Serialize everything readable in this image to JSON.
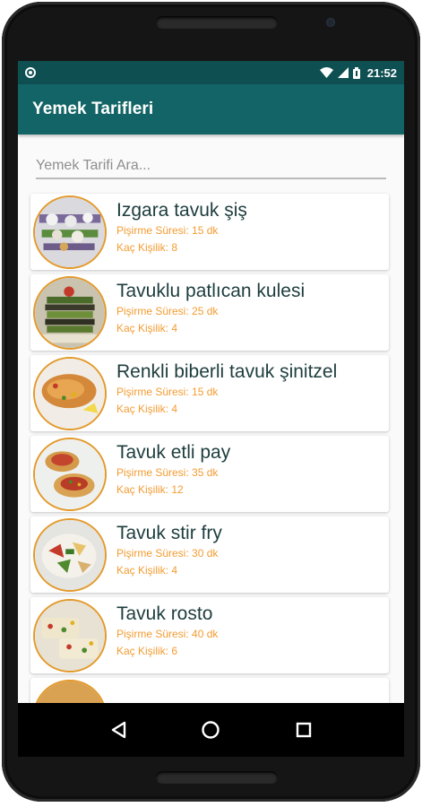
{
  "status_bar": {
    "time": "21:52",
    "left_icon": "circle-notification-icon",
    "right_icons": [
      "wifi-icon",
      "signal-icon",
      "battery-icon"
    ]
  },
  "app_bar": {
    "title": "Yemek Tarifleri"
  },
  "search": {
    "placeholder": "Yemek Tarifi Ara..."
  },
  "recipes": [
    {
      "title": "Izgara tavuk şiş",
      "cook_time": "Pişirme Süresi: 15 dk",
      "servings": "Kaç Kişilik: 8",
      "image": "grilled-chicken-skewers-photo"
    },
    {
      "title": "Tavuklu patlıcan kulesi",
      "cook_time": "Pişirme Süresi: 25 dk",
      "servings": "Kaç Kişilik: 4",
      "image": "eggplant-tower-photo"
    },
    {
      "title": "Renkli biberli tavuk şinitzel",
      "cook_time": "Pişirme Süresi: 15 dk",
      "servings": "Kaç Kişilik: 4",
      "image": "chicken-schnitzel-photo"
    },
    {
      "title": "Tavuk etli pay",
      "cook_time": "Pişirme Süresi: 35 dk",
      "servings": "Kaç Kişilik: 12",
      "image": "chicken-pie-photo"
    },
    {
      "title": "Tavuk stir fry",
      "cook_time": "Pişirme Süresi: 30 dk",
      "servings": "Kaç Kişilik: 4",
      "image": "chicken-stir-fry-photo"
    },
    {
      "title": "Tavuk rosto",
      "cook_time": "Pişirme Süresi: 40 dk",
      "servings": "Kaç Kişilik: 6",
      "image": "roast-chicken-photo"
    }
  ],
  "nav_bar": {
    "buttons": [
      "back-icon",
      "home-icon",
      "recents-icon"
    ]
  },
  "colors": {
    "status_bar": "#0e4f52",
    "app_bar": "#136466",
    "meta_text": "#f39c32",
    "thumb_border": "#e39a2d"
  }
}
